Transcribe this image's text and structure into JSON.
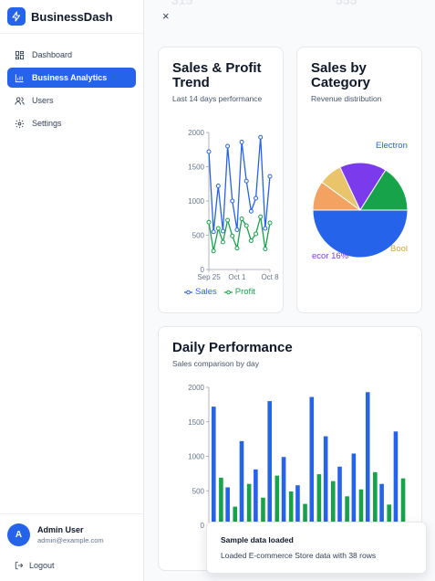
{
  "brand": {
    "name": "BusinessDash",
    "accent": "#2563eb"
  },
  "nav": [
    {
      "label": "Dashboard",
      "icon": "dashboard-icon",
      "active": false
    },
    {
      "label": "Business Analytics",
      "icon": "bar-chart-icon",
      "active": true
    },
    {
      "label": "Users",
      "icon": "users-icon",
      "active": false
    },
    {
      "label": "Settings",
      "icon": "gear-icon",
      "active": false
    }
  ],
  "user": {
    "initial": "A",
    "name": "Admin User",
    "email": "admin@example.com"
  },
  "logout_label": "Logout",
  "close_label": "×",
  "faded_stats": [
    "315",
    "555"
  ],
  "trend_card": {
    "title": "Sales & Profit Trend",
    "subtitle": "Last 14 days performance"
  },
  "category_card": {
    "title": "Sales by Category",
    "subtitle": "Revenue distribution"
  },
  "daily_card": {
    "title": "Daily Performance",
    "subtitle": "Sales comparison by day"
  },
  "toast": {
    "title": "Sample data loaded",
    "message": "Loaded E-commerce Store data with 38 rows"
  },
  "chart_data": [
    {
      "type": "line",
      "x_tick_labels": [
        "Sep 25",
        "Oct 1",
        "Oct 8"
      ],
      "y_ticks": [
        0,
        500,
        1000,
        1500,
        2000
      ],
      "ylim": [
        0,
        2000
      ],
      "legend_position": "bottom",
      "series": [
        {
          "name": "Sales",
          "color": "#2563eb",
          "values": [
            1720,
            550,
            1220,
            560,
            1800,
            1000,
            580,
            1860,
            1290,
            850,
            1040,
            1930,
            600,
            1360
          ]
        },
        {
          "name": "Profit",
          "color": "#16a34a",
          "values": [
            690,
            270,
            600,
            400,
            720,
            490,
            310,
            740,
            640,
            420,
            520,
            770,
            300,
            680
          ]
        }
      ]
    },
    {
      "type": "pie",
      "slices": [
        {
          "label": "Electronics",
          "value": 50,
          "color": "#2563eb"
        },
        {
          "label": "Books",
          "value": 10,
          "color": "#f4a261"
        },
        {
          "label": "Books",
          "value": 8,
          "color": "#e9c46a"
        },
        {
          "label": "Home Decor",
          "value": 16,
          "color": "#7c3aed"
        },
        {
          "label": "",
          "value": 16,
          "color": "#16a34a"
        }
      ],
      "visible_labels": [
        {
          "text": "Electron",
          "color": "#2563eb"
        },
        {
          "text": "Bool",
          "color": "#d4a72c"
        },
        {
          "text": "ecor 16%",
          "color": "#7c3aed"
        }
      ]
    },
    {
      "type": "bar",
      "y_ticks": [
        0,
        500,
        1000,
        1500,
        2000
      ],
      "ylim": [
        0,
        2000
      ],
      "series": [
        {
          "name": "Sales",
          "color": "#2563eb",
          "values": [
            1720,
            550,
            1220,
            810,
            1800,
            990,
            580,
            1860,
            1290,
            850,
            1040,
            1930,
            600,
            1360
          ]
        },
        {
          "name": "Profit",
          "color": "#16a34a",
          "values": [
            690,
            270,
            600,
            400,
            720,
            490,
            310,
            740,
            640,
            420,
            520,
            770,
            300,
            680
          ]
        }
      ]
    }
  ]
}
